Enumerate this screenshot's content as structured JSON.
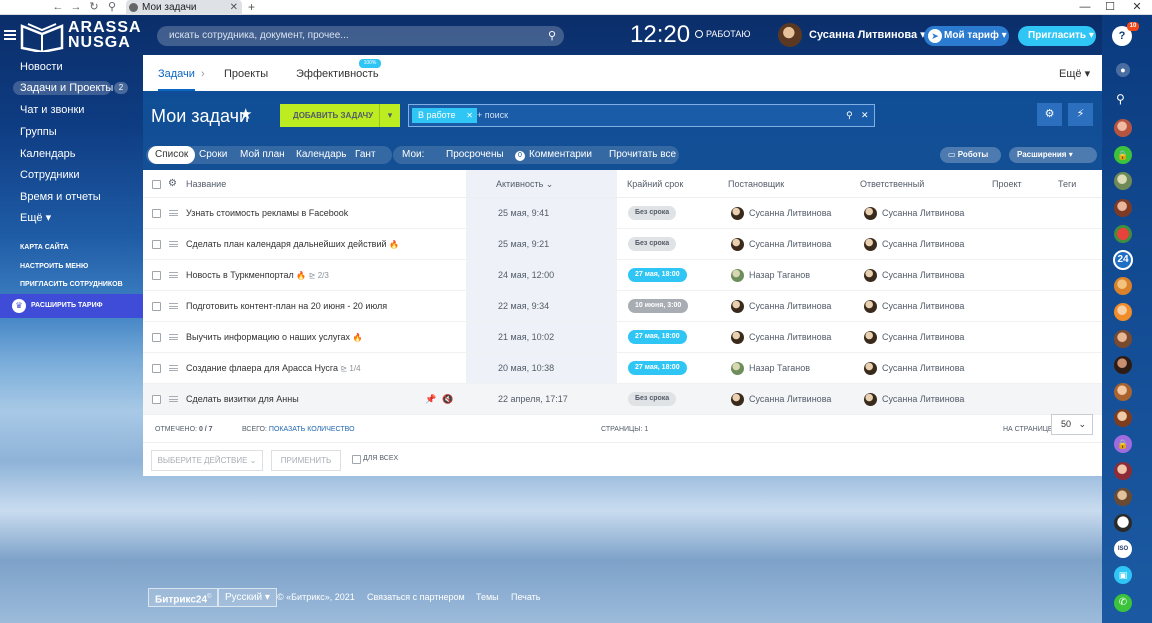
{
  "browser": {
    "tab_title": "Мои задачи",
    "new_tab": "+"
  },
  "header": {
    "logo_line1": "ARASSA",
    "logo_line2": "NUSGA",
    "search_placeholder": "искать сотрудника, документ, прочее...",
    "clock": "12:20",
    "work_status": "РАБОТАЮ",
    "user_name": "Сусанна Литвинова",
    "tariff_label": "Мой тариф",
    "invite_label": "Пригласить"
  },
  "leftnav": {
    "items": [
      "Новости",
      "Задачи и Проекты",
      "Чат и звонки",
      "Группы",
      "Календарь",
      "Сотрудники",
      "Время и отчеты",
      "Ещё"
    ],
    "badge": "2",
    "small_links": [
      "КАРТА САЙТА",
      "НАСТРОИТЬ МЕНЮ",
      "ПРИГЛАСИТЬ СОТРУДНИКОВ"
    ],
    "expand_label": "РАСШИРИТЬ ТАРИФ"
  },
  "topbar": {
    "tabs": [
      "Задачи",
      "Проекты",
      "Эффективность"
    ],
    "efficiency_pct": "100%",
    "more": "Ещё"
  },
  "toolbar": {
    "page_title": "Мои задачи",
    "add_task": "ДОБАВИТЬ ЗАДАЧУ",
    "filter_chip": "В работе",
    "filter_placeholder": "+ поиск",
    "views": [
      "Список",
      "Сроки",
      "Мой план",
      "Календарь",
      "Гант"
    ],
    "mine_label": "Мои:",
    "overdue": "Просрочены",
    "comments_count": "0",
    "comments": "Комментарии",
    "read_all": "Прочитать все",
    "robots": "Роботы",
    "extensions": "Расширения"
  },
  "grid": {
    "columns": [
      "Название",
      "Активность",
      "Крайний срок",
      "Постановщик",
      "Ответственный",
      "Проект",
      "Теги"
    ],
    "rows": [
      {
        "name": "Узнать стоимость рекламы в Facebook",
        "fire": "",
        "sub": "",
        "activity": "25 мая, 9:41",
        "deadline": "Без срока",
        "creator": "Сусанна Литвинова",
        "responsible": "Сусанна Литвинова"
      },
      {
        "name": "Сделать план календаря дальнейших действий",
        "fire": "🔥",
        "sub": "",
        "activity": "25 мая, 9:21",
        "deadline": "Без срока",
        "creator": "Сусанна Литвинова",
        "responsible": "Сусанна Литвинова"
      },
      {
        "name": "Новость в Туркменпортал",
        "fire": "🔥",
        "sub": "2/3",
        "activity": "24 мая, 12:00",
        "deadline": "27 мая, 18:00",
        "creator": "Назар Таганов",
        "responsible": "Сусанна Литвинова"
      },
      {
        "name": "Подготовить контент-план на 20 июня - 20 июля",
        "fire": "",
        "sub": "",
        "activity": "22 мая, 9:34",
        "deadline": "10 июня, 3:00",
        "creator": "Сусанна Литвинова",
        "responsible": "Сусанна Литвинова"
      },
      {
        "name": "Выучить информацию о наших услугах",
        "fire": "🔥",
        "sub": "",
        "activity": "21 мая, 10:02",
        "deadline": "27 мая, 18:00",
        "creator": "Сусанна Литвинова",
        "responsible": "Сусанна Литвинова"
      },
      {
        "name": "Создание флаера для Арасса Нусга",
        "fire": "",
        "sub": "1/4",
        "activity": "20 мая, 10:38",
        "deadline": "27 мая, 18:00",
        "creator": "Назар Таганов",
        "responsible": "Сусанна Литвинова"
      },
      {
        "name": "Сделать визитки для Анны",
        "fire": "",
        "sub": "",
        "activity": "22 апреля, 17:17",
        "deadline": "Без срока",
        "creator": "Сусанна Литвинова",
        "responsible": "Сусанна Литвинова"
      }
    ],
    "marked_label": "ОТМЕЧЕНО:",
    "marked_value": "0 / 7",
    "total_label": "ВСЕГО:",
    "show_count": "ПОКАЗАТЬ КОЛИЧЕСТВО",
    "pages_label": "СТРАНИЦЫ:",
    "pages_value": "1",
    "per_page_label": "НА СТРАНИЦЕ:",
    "per_page_value": "50",
    "choose_action": "ВЫБЕРИТЕ ДЕЙСТВИЕ",
    "apply": "ПРИМЕНИТЬ",
    "for_all": "ДЛЯ ВСЕХ"
  },
  "rightbar": {
    "notif_count": "10",
    "b24": "24",
    "iso": "ISO"
  },
  "footer": {
    "bitrix": "Битрикс24",
    "lang": "Русский",
    "copyright": "© «Битрикс», 2021",
    "partner": "Связаться с партнером",
    "themes": "Темы",
    "print": "Печать"
  }
}
